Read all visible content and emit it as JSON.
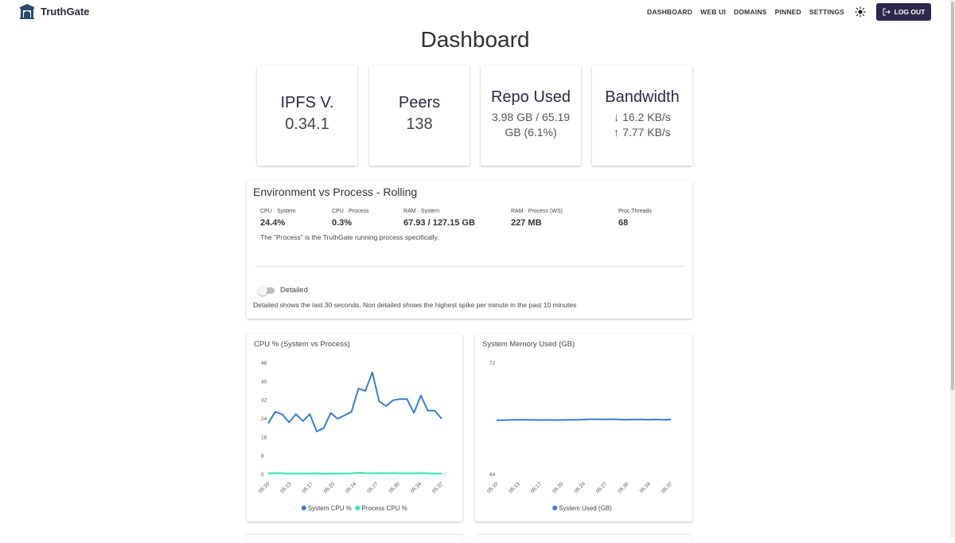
{
  "app": {
    "name": "TruthGate"
  },
  "nav": {
    "dashboard": "DASHBOARD",
    "webui": "WEB UI",
    "domains": "DOMAINS",
    "pinned": "PINNED",
    "settings": "SETTINGS",
    "logout": "LOG OUT",
    "theme_icon": "sun-icon",
    "logout_icon": "logout-icon"
  },
  "page": {
    "title": "Dashboard"
  },
  "stats": {
    "ipfs": {
      "title": "IPFS V.",
      "value": "0.34.1"
    },
    "peers": {
      "title": "Peers",
      "value": "138"
    },
    "repo": {
      "title": "Repo Used",
      "line1": "3.98 GB / 65.19",
      "line2": "GB (6.1%)"
    },
    "bandwidth": {
      "title": "Bandwidth",
      "down": "↓ 16.2 KB/s",
      "up": "↑ 7.77 KB/s"
    }
  },
  "env": {
    "title": "Environment vs Process - Rolling",
    "metrics": [
      {
        "label": "CPU · System",
        "value": "24.4%"
      },
      {
        "label": "CPU · Process",
        "value": "0.3%"
      },
      {
        "label": "RAM · System",
        "value": "67.93 / 127.15 GB"
      },
      {
        "label": "RAM · Process (WS)",
        "value": "227 MB"
      },
      {
        "label": "Proc Threads",
        "value": "68"
      }
    ],
    "note": "The \"Process\" is the TruthGate running process specifically.",
    "toggle_label": "Detailed",
    "toggle_on": false,
    "help": "Detailed shows the last 30 seconds. Non detailed shows the highest spike per minute in the past 10 minutes"
  },
  "colors": {
    "accent": "#2b2a4c",
    "system_series": "#3a7bd5",
    "process_series": "#2ee6b0"
  },
  "chart_data": [
    {
      "type": "line",
      "title": "CPU % (System vs Process)",
      "x": [
        "05:10",
        "05:11",
        "05:12",
        "05:13",
        "05:14",
        "05:15",
        "05:16",
        "05:17",
        "05:18",
        "05:19",
        "05:20",
        "05:21",
        "05:22",
        "05:23",
        "05:24",
        "05:25",
        "05:26",
        "05:27",
        "05:28",
        "05:29",
        "05:30",
        "05:31",
        "05:32",
        "05:33",
        "05:34",
        "05:35",
        "05:36",
        "05:37"
      ],
      "x_tick_labels": [
        "05:10",
        "05:13",
        "05:17",
        "05:20",
        "05:24",
        "05:27",
        "05:30",
        "05:34",
        "05:37"
      ],
      "ylim": [
        0,
        48
      ],
      "y_ticks": [
        0,
        8,
        16,
        24,
        32,
        40,
        48
      ],
      "series": [
        {
          "name": "System CPU %",
          "values": [
            22,
            27,
            26,
            22.5,
            26,
            23,
            26,
            18.5,
            20,
            26.5,
            24,
            25.5,
            27,
            37,
            36,
            44,
            31.5,
            29.5,
            32,
            32.5,
            32.5,
            26.5,
            34,
            27.5,
            27.5,
            24
          ]
        },
        {
          "name": "Process CPU %",
          "values": [
            0.5,
            0.6,
            0.5,
            0.4,
            0.5,
            0.4,
            0.4,
            0.5,
            0.3,
            0.4,
            0.4,
            0.4,
            0.5,
            0.8,
            0.6,
            0.5,
            0.6,
            0.5,
            0.6,
            0.5,
            0.5,
            0.5,
            0.6,
            0.5,
            0.4,
            0.4
          ]
        }
      ],
      "legend": "bottom"
    },
    {
      "type": "line",
      "title": "System Memory Used (GB)",
      "x": [
        "05:10",
        "05:11",
        "05:12",
        "05:13",
        "05:14",
        "05:15",
        "05:16",
        "05:17",
        "05:18",
        "05:19",
        "05:20",
        "05:21",
        "05:22",
        "05:23",
        "05:24",
        "05:25",
        "05:26",
        "05:27",
        "05:28",
        "05:29",
        "05:30",
        "05:31",
        "05:32",
        "05:33",
        "05:34",
        "05:35",
        "05:36",
        "05:37"
      ],
      "x_tick_labels": [
        "05:10",
        "05:13",
        "05:17",
        "05:20",
        "05:24",
        "05:27",
        "05:30",
        "05:34",
        "05:37"
      ],
      "ylim": [
        64,
        72
      ],
      "y_ticks": [
        64,
        72
      ],
      "series": [
        {
          "name": "System Used (GB)",
          "values": [
            67.9,
            67.9,
            67.92,
            67.93,
            67.93,
            67.92,
            67.91,
            67.92,
            67.91,
            67.92,
            67.93,
            67.94,
            67.96,
            67.97,
            67.96,
            67.97,
            67.96,
            67.94,
            67.95,
            67.96,
            67.94,
            67.95,
            67.93,
            67.95
          ]
        }
      ],
      "legend": "bottom"
    }
  ]
}
